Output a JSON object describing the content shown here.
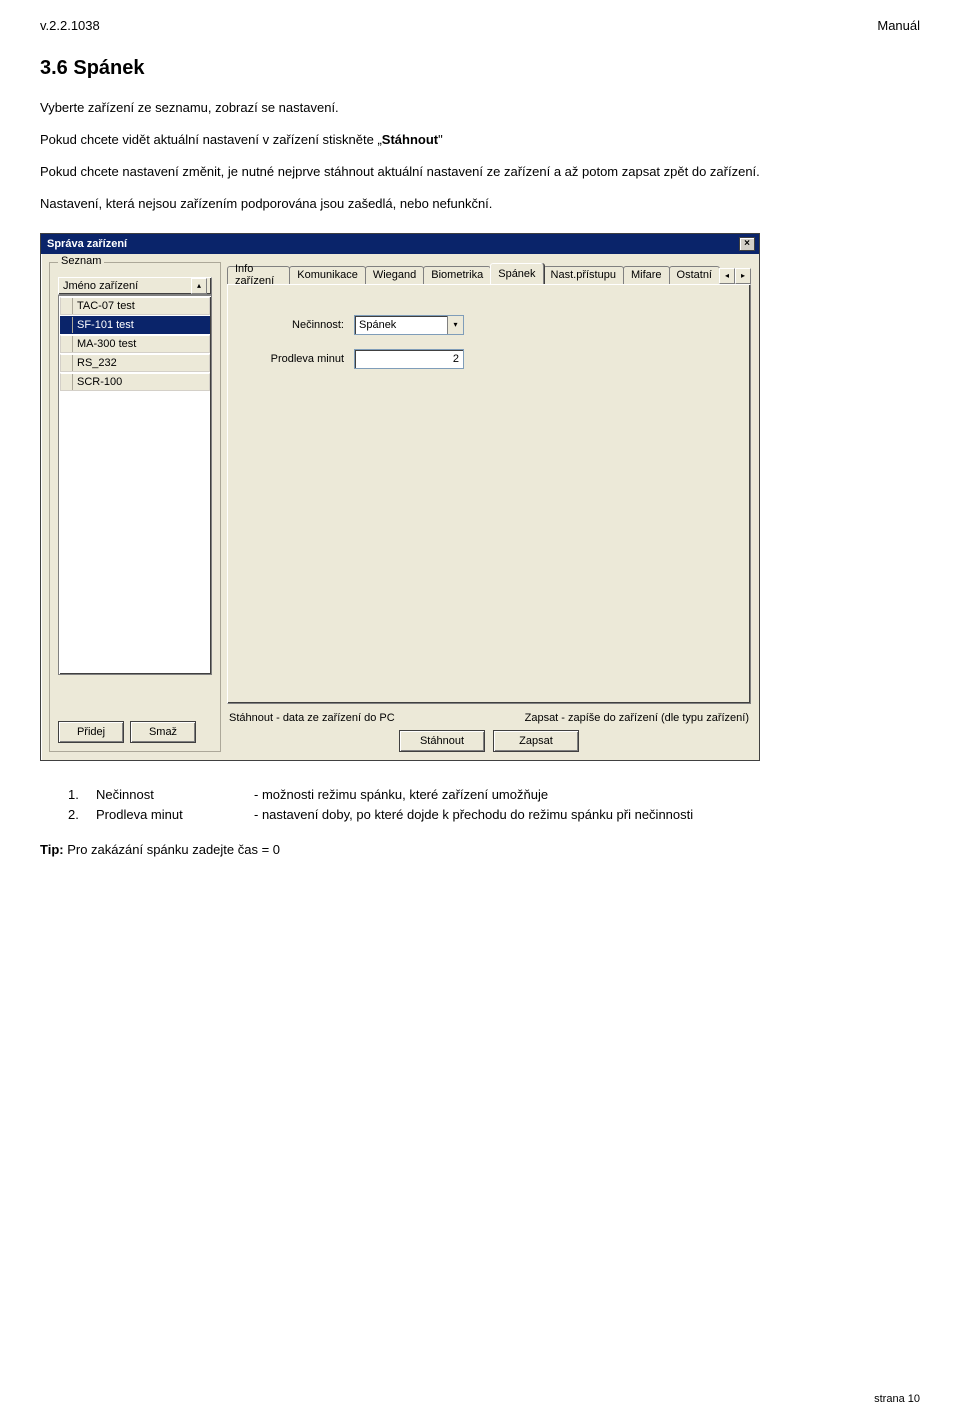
{
  "header": {
    "version": "v.2.2.1038",
    "doc_label": "Manuál"
  },
  "section": {
    "title": "3.6 Spánek"
  },
  "para1": "Vyberte zařízení ze seznamu, zobrazí se nastavení.",
  "para2a": "Pokud chcete vidět aktuální nastavení v zařízení stiskněte „",
  "para2b_bold": "Stáhnout",
  "para2c": "\"",
  "para3": "Pokud chcete nastavení změnit, je nutné nejprve stáhnout aktuální nastavení ze zařízení a až potom zapsat zpět do zařízení.",
  "para4": "Nastavení, která nejsou zařízením podporována jsou zašedlá, nebo nefunkční.",
  "window": {
    "title": "Správa zařízení",
    "close_glyph": "×",
    "group_label": "Seznam",
    "list_header": "Jméno zařízení",
    "scroll_up_glyph": "▴",
    "devices": [
      {
        "name": "TAC-07 test",
        "selected": false
      },
      {
        "name": "SF-101 test",
        "selected": true
      },
      {
        "name": "MA-300 test",
        "selected": false
      },
      {
        "name": "RS_232",
        "selected": false
      },
      {
        "name": "SCR-100",
        "selected": false
      }
    ],
    "btn_add": "Přidej",
    "btn_del": "Smaž",
    "tabs": [
      {
        "label": "Info zařízení",
        "active": false
      },
      {
        "label": "Komunikace",
        "active": false
      },
      {
        "label": "Wiegand",
        "active": false
      },
      {
        "label": "Biometrika",
        "active": false
      },
      {
        "label": "Spánek",
        "active": true
      },
      {
        "label": "Nast.přístupu",
        "active": false
      },
      {
        "label": "Mifare",
        "active": false
      },
      {
        "label": "Ostatní",
        "active": false
      }
    ],
    "tab_arrow_left": "◂",
    "tab_arrow_right": "▸",
    "form": {
      "inactivity_label": "Nečinnost:",
      "inactivity_value": "Spánek",
      "combo_arrow": "▾",
      "delay_label": "Prodleva minut",
      "delay_value": "2"
    },
    "hint_left": "Stáhnout - data ze zařízení do PC",
    "hint_right": "Zapsat - zapíše do zařízení (dle typu zařízení)",
    "btn_download": "Stáhnout",
    "btn_write": "Zapsat"
  },
  "numbered": [
    {
      "n": "1.",
      "label": "Nečinnost",
      "desc": "- možnosti režimu spánku, které zařízení umožňuje"
    },
    {
      "n": "2.",
      "label": "Prodleva minut",
      "desc": "- nastavení doby, po které dojde k přechodu do režimu spánku při  nečinnosti"
    }
  ],
  "tip_bold": "Tip:",
  "tip_text": " Pro zakázání spánku zadejte čas = 0",
  "footer": "strana 10"
}
